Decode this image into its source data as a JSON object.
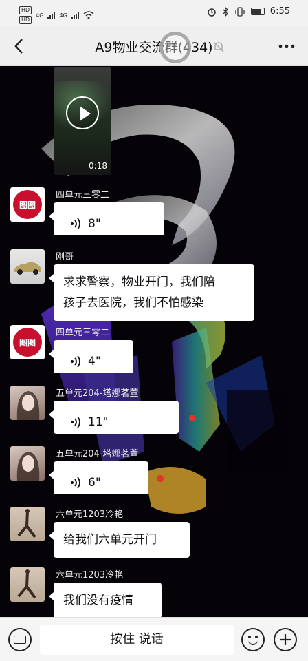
{
  "status_bar": {
    "left_badges": [
      "HD",
      "HD"
    ],
    "network_labels": [
      "4G",
      "4G"
    ],
    "time": "6:55"
  },
  "header": {
    "back_icon": "chevron-left-icon",
    "title": "A9物业交流群(434)",
    "mute_icon": "bell-off-icon",
    "more_icon": "more-dots-icon"
  },
  "video": {
    "duration": "0:18",
    "play_icon": "play-icon"
  },
  "messages": [
    {
      "sender": "四单元三零二",
      "type": "voice",
      "duration": "8\"",
      "avatar_text": "图图"
    },
    {
      "sender": "刚哥",
      "type": "text",
      "lines": [
        "求求警察，物业开门，我们陪",
        "孩子去医院，我们不怕感染"
      ]
    },
    {
      "sender": "四单元三零二",
      "type": "voice",
      "duration": "4\"",
      "avatar_text": "图图"
    },
    {
      "sender": "五单元204-塔娜茗萱",
      "type": "voice",
      "duration": "11\""
    },
    {
      "sender": "五单元204-塔娜茗萱",
      "type": "voice",
      "duration": "6\""
    },
    {
      "sender": "六单元1203冷艳",
      "type": "text",
      "lines": [
        "给我们六单元开门"
      ]
    },
    {
      "sender": "六单元1203冷艳",
      "type": "text",
      "lines": [
        "我们没有疫情"
      ]
    }
  ],
  "input_bar": {
    "hold_to_talk": "按住 说话",
    "keyboard_icon": "keyboard-icon",
    "emoji_icon": "emoji-icon",
    "plus_icon": "plus-icon"
  },
  "colors": {
    "header_bg": "#efefef",
    "bubble_bg": "#ffffff",
    "sender_text": "#e9e9e9",
    "avatar_red": "#c8102e"
  }
}
